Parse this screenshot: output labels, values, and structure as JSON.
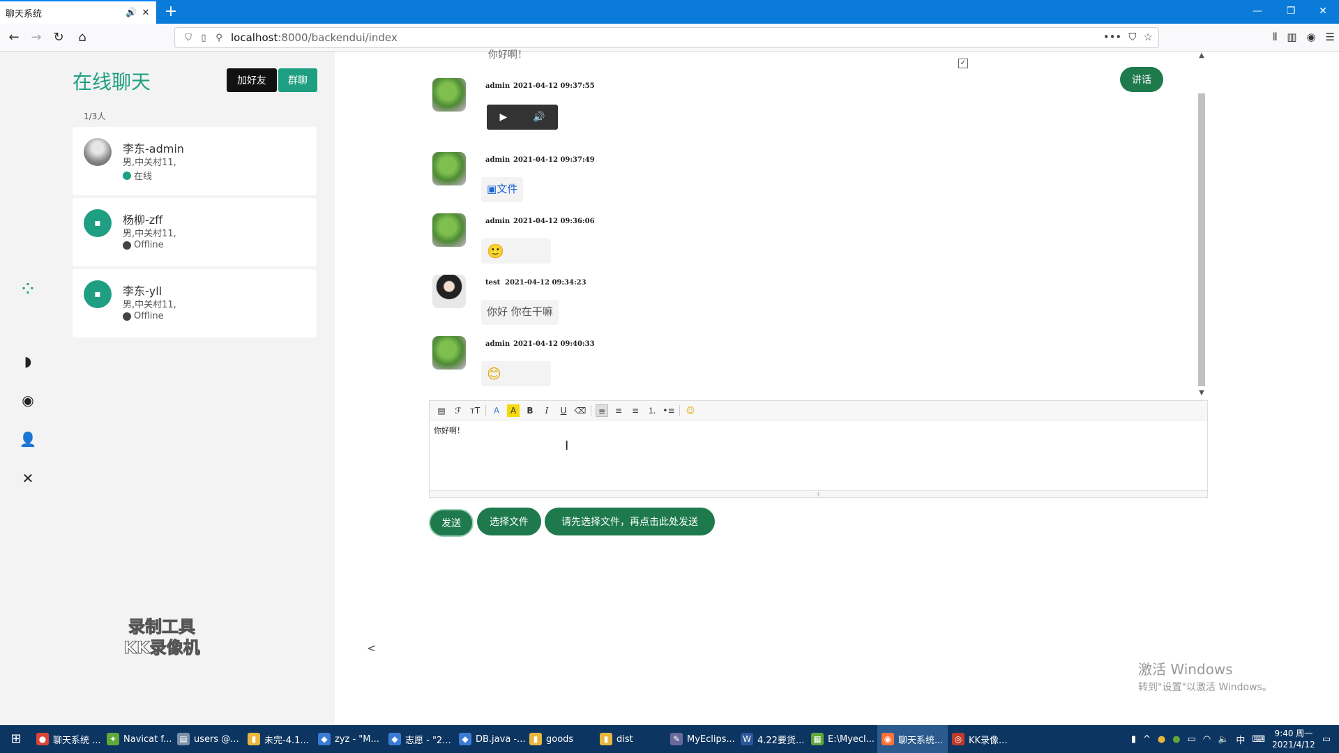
{
  "browser": {
    "tab_title": "聊天系统",
    "url_host": "localhost",
    "url_path": ":8000/backendui/index"
  },
  "sidebar": {
    "title": "在线聊天",
    "add_friend": "加好友",
    "group_chat": "群聊",
    "count": "1/3人",
    "contacts": [
      {
        "name": "李东-admin",
        "info": "男,中关村11,",
        "status": "在线",
        "status_color": "#1e9f81"
      },
      {
        "name": "杨柳-zff",
        "info": "男,中关村11,",
        "status": "Offline",
        "status_color": "#444444"
      },
      {
        "name": "李东-yll",
        "info": "男,中关村11,",
        "status": "Offline",
        "status_color": "#444444"
      }
    ]
  },
  "chat": {
    "prev_message": "你好啊！",
    "talk_button": "讲话",
    "messages": [
      {
        "user": "admin",
        "time": "2021-04-12 09:37:55",
        "type": "audio"
      },
      {
        "user": "admin",
        "time": "2021-04-12 09:37:49",
        "type": "file",
        "text": "文件"
      },
      {
        "user": "admin",
        "time": "2021-04-12 09:36:06",
        "type": "emoji",
        "text": "🙂"
      },
      {
        "user": "test",
        "time": "2021-04-12 09:34:23",
        "type": "text",
        "text": "你好 你在干嘛"
      },
      {
        "user": "admin",
        "time": "2021-04-12 09:40:33",
        "type": "emoji",
        "text": "😊"
      }
    ]
  },
  "editor": {
    "content": "你好啊！"
  },
  "buttons": {
    "send": "发送",
    "pick_file": "选择文件",
    "send_file": "请先选择文件，再点击此处发送"
  },
  "watermark": {
    "line1": "录制工具",
    "line2": "KK录像机"
  },
  "activation": {
    "line1": "激活 Windows",
    "line2": "转到\"设置\"以激活 Windows。"
  },
  "taskbar": {
    "items": [
      {
        "label": "聊天系统 ...",
        "icon_color": "#db4437"
      },
      {
        "label": "Navicat f...",
        "icon_color": "#5fa83a"
      },
      {
        "label": "users @...",
        "icon_color": "#7a8fa8"
      },
      {
        "label": "未完-4.1...",
        "icon_color": "#e9b640"
      },
      {
        "label": "zyz - \"M...",
        "icon_color": "#3a7bd5"
      },
      {
        "label": "志愿 - \"2...",
        "icon_color": "#3a7bd5"
      },
      {
        "label": "DB.java -...",
        "icon_color": "#3a7bd5"
      },
      {
        "label": "goods",
        "icon_color": "#e9b640"
      },
      {
        "label": "dist",
        "icon_color": "#e9b640"
      },
      {
        "label": "MyEclips...",
        "icon_color": "#6a6a9a"
      },
      {
        "label": "4.22要货...",
        "icon_color": "#2b579a"
      },
      {
        "label": "E:\\Myecl...",
        "icon_color": "#5fa83a"
      },
      {
        "label": "聊天系统...",
        "icon_color": "#ff7139"
      },
      {
        "label": "KK录像...",
        "icon_color": "#c0392b"
      }
    ],
    "ime": "中",
    "time": "9:40 周一",
    "date": "2021/4/12"
  }
}
